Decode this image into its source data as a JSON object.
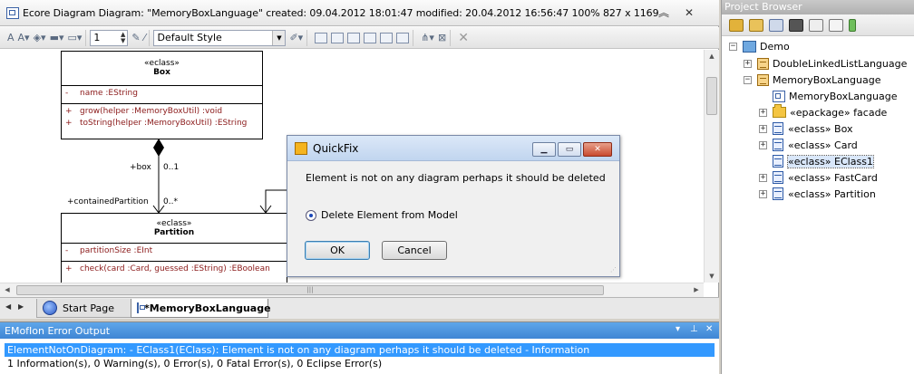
{
  "document": {
    "title": "Ecore Diagram Diagram: \"MemoryBoxLanguage\"   created: 09.04.2012 18:01:47  modified: 20.04.2012 16:56:47   100%   827 x 1169",
    "toolbar": {
      "line_width": "1",
      "style": "Default Style"
    }
  },
  "diagram": {
    "box": {
      "stereotype": "«eclass»",
      "name": "Box",
      "attributes": [
        {
          "vis": "-",
          "text": "name  :EString"
        }
      ],
      "operations": [
        {
          "vis": "+",
          "text": "grow(helper :MemoryBoxUtil)  :void"
        },
        {
          "vis": "+",
          "text": "toString(helper :MemoryBoxUtil)  :EString"
        }
      ]
    },
    "partition": {
      "stereotype": "«eclass»",
      "name": "Partition",
      "attributes": [
        {
          "vis": "-",
          "text": "partitionSize  :EInt"
        }
      ],
      "operations": [
        {
          "vis": "+",
          "text": "check(card :Card, guessed :EString)  :EBoolean"
        }
      ]
    },
    "association": {
      "source_role": "+box",
      "source_mult": "0..1",
      "target_role": "+containedPartition",
      "target_mult": "0..*"
    }
  },
  "tabs": [
    {
      "label": "Start Page"
    },
    {
      "label": "*MemoryBoxLanguage"
    }
  ],
  "error_output": {
    "title": "EMofIon Error Output",
    "selected_row": "ElementNotOnDiagram: - EClass1(EClass): Element is not on any diagram perhaps it should be deleted - Information",
    "summary": "1 Information(s), 0 Warning(s), 0 Error(s), 0 Fatal Error(s), 0 Eclipse Error(s)"
  },
  "project_browser": {
    "title": "Project Browser",
    "items": [
      {
        "label": "Demo"
      },
      {
        "label": "DoubleLinkedListLanguage"
      },
      {
        "label": "MemoryBoxLanguage"
      },
      {
        "label": "MemoryBoxLanguage"
      },
      {
        "label": "«epackage» facade"
      },
      {
        "label": "«eclass» Box"
      },
      {
        "label": "«eclass» Card"
      },
      {
        "label": "«eclass» EClass1"
      },
      {
        "label": "«eclass» FastCard"
      },
      {
        "label": "«eclass» Partition"
      }
    ]
  },
  "dialog": {
    "title": "QuickFix",
    "message": "Element is not on any diagram perhaps it should be deleted",
    "option": "Delete Element from Model",
    "option_selected": true,
    "ok_label": "OK",
    "cancel_label": "Cancel"
  },
  "colors": {
    "selection": "#3399ff",
    "panel_header": "#4b93dd",
    "attribute_text": "#8b1a1a"
  }
}
